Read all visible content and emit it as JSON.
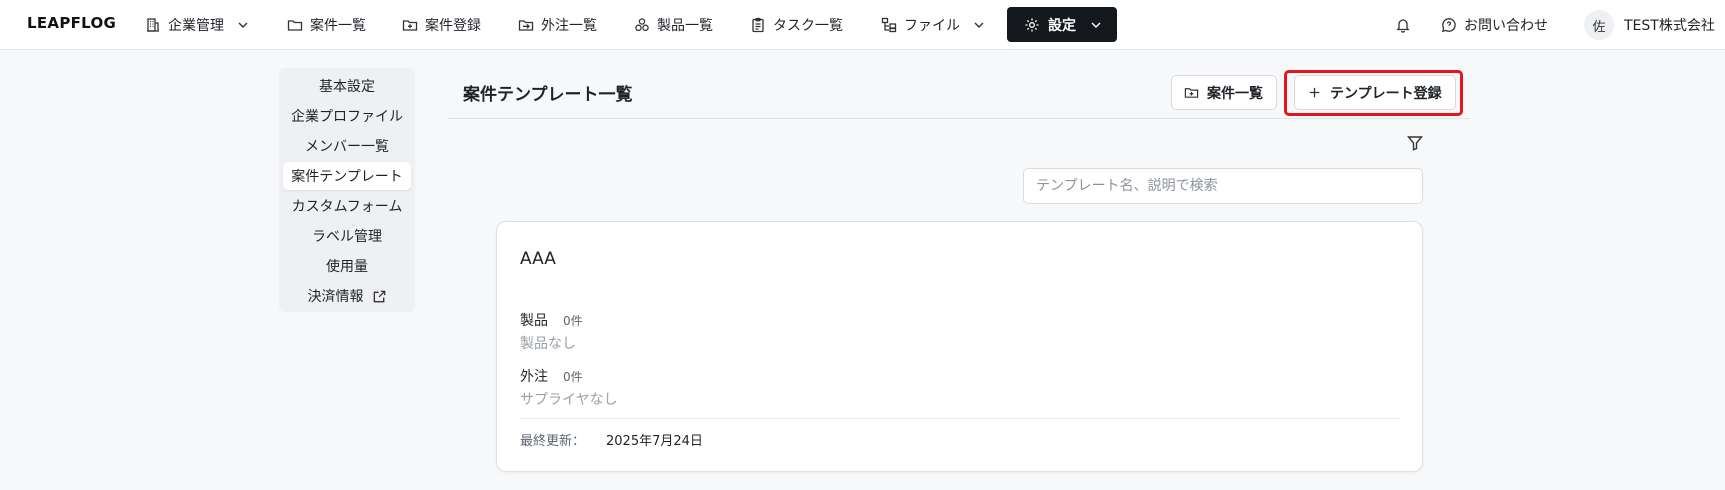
{
  "app": {
    "logo": "LEAPFLOG"
  },
  "nav": {
    "company_mgmt": "企業管理",
    "cases": "案件一覧",
    "case_register": "案件登録",
    "outsourcing": "外注一覧",
    "products": "製品一覧",
    "tasks": "タスク一覧",
    "files": "ファイル",
    "settings": "設定",
    "contact": "お問い合わせ",
    "avatar_initial": "佐",
    "company_name": "TEST株式会社"
  },
  "sidebar": {
    "items": [
      {
        "label": "基本設定"
      },
      {
        "label": "企業プロファイル"
      },
      {
        "label": "メンバー一覧"
      },
      {
        "label": "案件テンプレート"
      },
      {
        "label": "カスタムフォーム"
      },
      {
        "label": "ラベル管理"
      },
      {
        "label": "使用量"
      },
      {
        "label": "決済情報"
      }
    ]
  },
  "main": {
    "title": "案件テンプレート一覧",
    "btn_case_list": "案件一覧",
    "btn_new_template": "テンプレート登録",
    "search_placeholder": "テンプレート名、説明で検索"
  },
  "card": {
    "title": "AAA",
    "product_label": "製品",
    "product_count": "0件",
    "product_empty": "製品なし",
    "outsourcing_label": "外注",
    "outsourcing_count": "0件",
    "outsourcing_empty": "サプライヤなし",
    "updated_label": "最終更新：",
    "updated_value": "2025年7月24日"
  },
  "colors": {
    "active_nav": "#15181c",
    "highlight": "#e3161c"
  }
}
